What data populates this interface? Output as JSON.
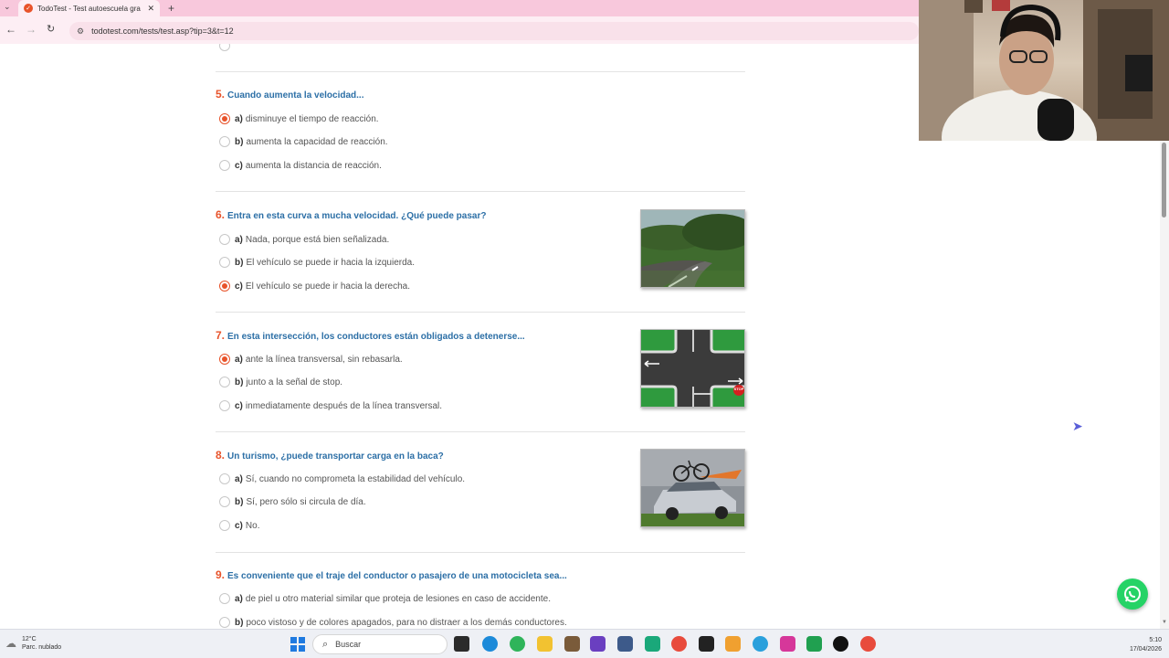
{
  "browser": {
    "tab_title": "TodoTest - Test autoescuela gra",
    "url": "todotest.com/tests/test.asp?tip=3&t=12"
  },
  "questions": [
    {
      "number": "5.",
      "text": "Cuando aumenta la velocidad...",
      "options": [
        {
          "letter": "a)",
          "text": "disminuye el tiempo de reacción.",
          "selected": true
        },
        {
          "letter": "b)",
          "text": "aumenta la capacidad de reacción.",
          "selected": false
        },
        {
          "letter": "c)",
          "text": "aumenta la distancia de reacción.",
          "selected": false
        }
      ]
    },
    {
      "number": "6.",
      "text": "Entra en esta curva a mucha velocidad. ¿Qué puede pasar?",
      "options": [
        {
          "letter": "a)",
          "text": "Nada, porque está bien señalizada.",
          "selected": false
        },
        {
          "letter": "b)",
          "text": "El vehículo se puede ir hacia la izquierda.",
          "selected": false
        },
        {
          "letter": "c)",
          "text": "El vehículo se puede ir hacia la derecha.",
          "selected": true
        }
      ]
    },
    {
      "number": "7.",
      "text": "En esta intersección, los conductores están obligados a detenerse...",
      "options": [
        {
          "letter": "a)",
          "text": "ante la línea transversal, sin rebasarla.",
          "selected": true
        },
        {
          "letter": "b)",
          "text": "junto a la señal de stop.",
          "selected": false
        },
        {
          "letter": "c)",
          "text": "inmediatamente después de la línea transversal.",
          "selected": false
        }
      ]
    },
    {
      "number": "8.",
      "text": "Un turismo, ¿puede transportar carga en la baca?",
      "options": [
        {
          "letter": "a)",
          "text": "Sí, cuando no comprometa la estabilidad del vehículo.",
          "selected": false
        },
        {
          "letter": "b)",
          "text": "Sí, pero sólo si circula de día.",
          "selected": false
        },
        {
          "letter": "c)",
          "text": "No.",
          "selected": false
        }
      ]
    },
    {
      "number": "9.",
      "text": "Es conveniente que el traje del conductor o pasajero de una motocicleta sea...",
      "options": [
        {
          "letter": "a)",
          "text": "de piel u otro material similar que proteja de lesiones en caso de accidente.",
          "selected": false
        },
        {
          "letter": "b)",
          "text": "poco vistoso y de colores apagados, para no distraer a los demás conductores.",
          "selected": false
        }
      ]
    }
  ],
  "stop_sign_text": "STOP",
  "taskbar": {
    "weather_temp": "12°C",
    "weather_desc": "Parc. nublado",
    "search_placeholder": "Buscar",
    "time": "5:10",
    "date": "17/04/2026"
  },
  "colors": {
    "accent": "#e8532a",
    "question_blue": "#2c6fa6",
    "tabbar_pink": "#f8c8dc"
  }
}
